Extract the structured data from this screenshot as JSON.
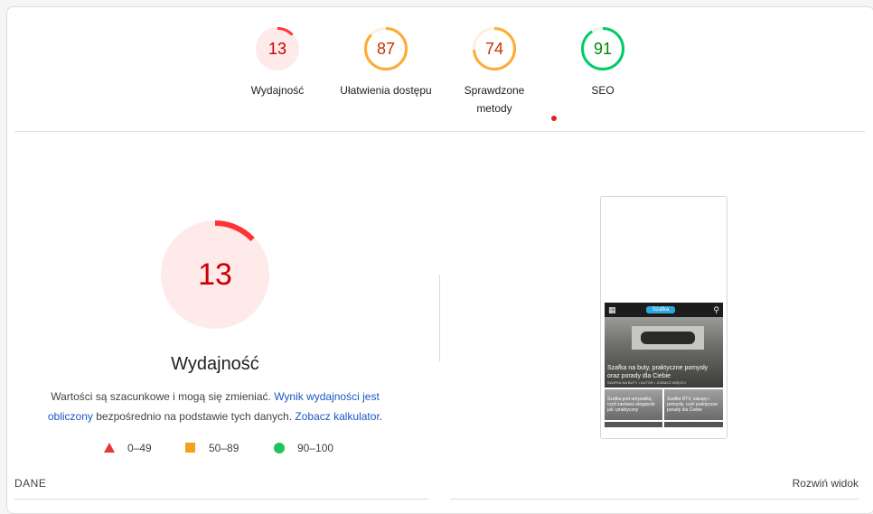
{
  "categories": [
    {
      "id": "performance",
      "score": "13",
      "value": 13,
      "label": "Wydajność",
      "color": "#cc0000",
      "fill": "#ffeaea",
      "track": "#ffeaea",
      "arc": "#ff3333"
    },
    {
      "id": "accessibility",
      "score": "87",
      "value": 87,
      "label": "Ułatwienia dostępu",
      "color": "#c33300",
      "fill": "#ffffff",
      "track": "#fdf0e0",
      "arc": "#ffaa33"
    },
    {
      "id": "best-practices",
      "score": "74",
      "value": 74,
      "label": "Sprawdzone metody",
      "color": "#c33300",
      "fill": "#ffffff",
      "track": "#fdf0e0",
      "arc": "#ffaa33"
    },
    {
      "id": "seo",
      "score": "91",
      "value": 91,
      "label": "SEO",
      "color": "#008800",
      "fill": "#ffffff",
      "track": "#e6f7ea",
      "arc": "#00cc66"
    }
  ],
  "performance": {
    "score": "13",
    "value": 13,
    "title": "Wydajność",
    "desc_before": "Wartości są szacunkowe i mogą się zmieniać. ",
    "link_metric": "Wynik wydajności jest obliczony",
    "desc_middle": " bezpośrednio na podstawie tych danych. ",
    "link_calc": "Zobacz kalkulator",
    "desc_after": "."
  },
  "legend": [
    {
      "shape": "triangle",
      "label": "0–49",
      "color": "#e53935"
    },
    {
      "shape": "square",
      "label": "50–89",
      "color": "#f4a21d"
    },
    {
      "shape": "circle",
      "label": "90–100",
      "color": "#1fc45a"
    }
  ],
  "screenshot": {
    "logo_text": "Szafka",
    "hero_title": "Szafka na buty, praktyczne pomysły oraz porady dla Ciebie",
    "hero_meta": "SZAFKA NA BUTY • AUTOR • ZOBACZ WIĘCEJ",
    "tile_left": "Szafka pod umywalkę, czyli zarówno elegancki jak i praktyczny",
    "tile_right": "Szafka RTV, zakupy i pomysły, czyli praktyczne porady dla Ciebie"
  },
  "footer": {
    "left": "DANE",
    "right": "Rozwiń widok"
  }
}
